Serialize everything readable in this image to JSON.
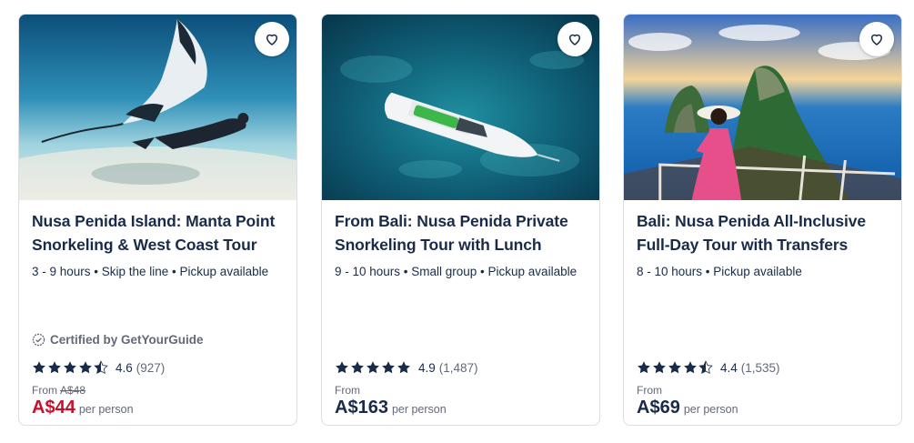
{
  "cards": [
    {
      "title": "Nusa Penida Island: Manta Point Snorkeling & West Coast Tour",
      "meta": "3 - 9 hours • Skip the line • Pickup available",
      "certified": "Certified by GetYourGuide",
      "stars": 4.5,
      "rating": "4.6",
      "reviews": "(927)",
      "from_label": "From",
      "old_price": "A$48",
      "price": "A$44",
      "per_person": "per person",
      "image_icon": "manta-ray-snorkel-photo",
      "wishlist_icon": "heart-icon"
    },
    {
      "title": "From Bali: Nusa Penida Private Snorkeling Tour with Lunch",
      "meta": "9 - 10 hours • Small group • Pickup available",
      "stars": 5,
      "rating": "4.9",
      "reviews": "(1,487)",
      "from_label": "From",
      "price": "A$163",
      "per_person": "per person",
      "image_icon": "speedboat-ocean-photo",
      "wishlist_icon": "heart-icon"
    },
    {
      "title": "Bali: Nusa Penida All-Inclusive Full-Day Tour with Transfers",
      "meta": "8 - 10 hours • Pickup available",
      "stars": 4.5,
      "rating": "4.4",
      "reviews": "(1,535)",
      "from_label": "From",
      "price": "A$69",
      "per_person": "per person",
      "image_icon": "cliff-viewpoint-photo",
      "wishlist_icon": "heart-icon"
    }
  ],
  "colors": {
    "text": "#1a2b49",
    "muted": "#63687a",
    "sale": "#c8102e",
    "border": "#dcdfe4"
  }
}
